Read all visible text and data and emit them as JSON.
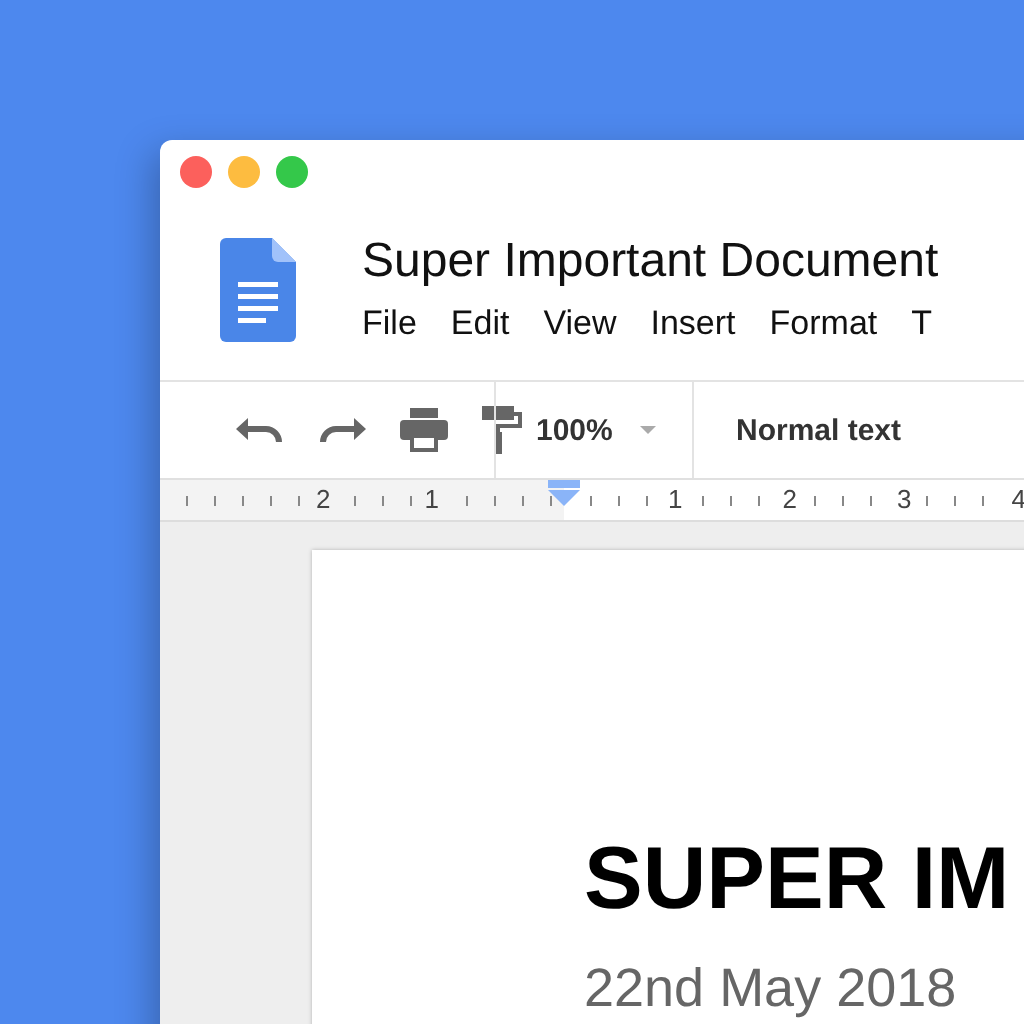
{
  "window": {
    "title": "Super Important Document",
    "controls": [
      {
        "color": "#fc605c"
      },
      {
        "color": "#fdbc40"
      },
      {
        "color": "#34c84a"
      }
    ]
  },
  "menu": [
    "File",
    "Edit",
    "View",
    "Insert",
    "Format",
    "T"
  ],
  "toolbar": {
    "zoom": "100%",
    "style": "Normal text"
  },
  "ruler": {
    "left_labels": [
      "2",
      "1"
    ],
    "right_labels": [
      "1",
      "2",
      "3",
      "4"
    ]
  },
  "document": {
    "heading": "SUPER IM",
    "date": "22nd May 2018"
  }
}
